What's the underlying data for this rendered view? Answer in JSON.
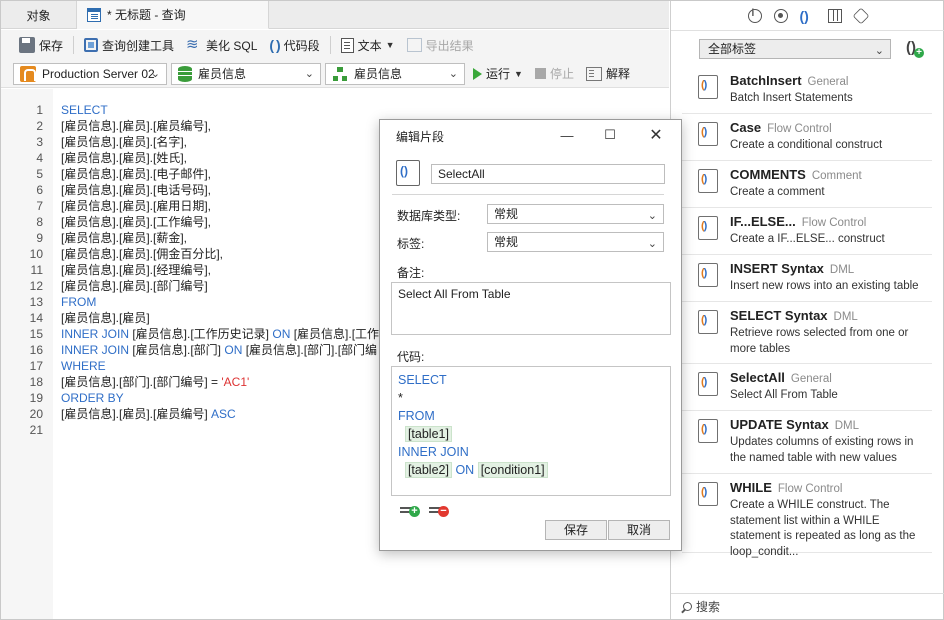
{
  "tabs": {
    "objects": "对象",
    "query": "* 无标题 - 查询"
  },
  "toolbar": {
    "save": "保存",
    "query_builder": "查询创建工具",
    "beautify": "美化 SQL",
    "code_snippet": "代码段",
    "text": "文本",
    "export": "导出结果"
  },
  "connection": {
    "server": "Production Server 02",
    "database": "雇员信息",
    "schema": "雇员信息",
    "run": "运行",
    "stop": "停止",
    "explain": "解释"
  },
  "editor": {
    "lines": [
      {
        "n": "1",
        "parts": [
          {
            "t": "SELECT",
            "k": "kw"
          }
        ]
      },
      {
        "n": "2",
        "parts": [
          {
            "t": "[雇员信息].[雇员].[雇员编号],",
            "k": ""
          }
        ]
      },
      {
        "n": "3",
        "parts": [
          {
            "t": "[雇员信息].[雇员].[名字],",
            "k": ""
          }
        ]
      },
      {
        "n": "4",
        "parts": [
          {
            "t": "[雇员信息].[雇员].[姓氏],",
            "k": ""
          }
        ]
      },
      {
        "n": "5",
        "parts": [
          {
            "t": "[雇员信息].[雇员].[电子邮件],",
            "k": ""
          }
        ]
      },
      {
        "n": "6",
        "parts": [
          {
            "t": "[雇员信息].[雇员].[电话号码],",
            "k": ""
          }
        ]
      },
      {
        "n": "7",
        "parts": [
          {
            "t": "[雇员信息].[雇员].[雇用日期],",
            "k": ""
          }
        ]
      },
      {
        "n": "8",
        "parts": [
          {
            "t": "[雇员信息].[雇员].[工作编号],",
            "k": ""
          }
        ]
      },
      {
        "n": "9",
        "parts": [
          {
            "t": "[雇员信息].[雇员].[薪金],",
            "k": ""
          }
        ]
      },
      {
        "n": "10",
        "parts": [
          {
            "t": "[雇员信息].[雇员].[佣金百分比],",
            "k": ""
          }
        ]
      },
      {
        "n": "11",
        "parts": [
          {
            "t": "[雇员信息].[雇员].[经理编号],",
            "k": ""
          }
        ]
      },
      {
        "n": "12",
        "parts": [
          {
            "t": "[雇员信息].[雇员].[部门编号]",
            "k": ""
          }
        ]
      },
      {
        "n": "13",
        "parts": [
          {
            "t": "FROM",
            "k": "kw"
          }
        ]
      },
      {
        "n": "14",
        "parts": [
          {
            "t": "[雇员信息].[雇员]",
            "k": ""
          }
        ]
      },
      {
        "n": "15",
        "parts": [
          {
            "t": "INNER JOIN",
            "k": "kw"
          },
          {
            "t": " [雇员信息].[工作历史记录] ",
            "k": ""
          },
          {
            "t": "ON",
            "k": "kw"
          },
          {
            "t": " [雇员信息].[工作",
            "k": ""
          }
        ]
      },
      {
        "n": "16",
        "parts": [
          {
            "t": "INNER JOIN",
            "k": "kw"
          },
          {
            "t": " [雇员信息].[部门] ",
            "k": ""
          },
          {
            "t": "ON",
            "k": "kw"
          },
          {
            "t": " [雇员信息].[部门].[部门编",
            "k": ""
          }
        ]
      },
      {
        "n": "17",
        "parts": [
          {
            "t": "WHERE",
            "k": "kw"
          }
        ]
      },
      {
        "n": "18",
        "parts": [
          {
            "t": "[雇员信息].[部门].[部门编号] = ",
            "k": ""
          },
          {
            "t": "'AC1'",
            "k": "str"
          }
        ]
      },
      {
        "n": "19",
        "parts": [
          {
            "t": "ORDER BY",
            "k": "kw"
          }
        ]
      },
      {
        "n": "20",
        "parts": [
          {
            "t": "[雇员信息].[雇员].[雇员编号] ",
            "k": ""
          },
          {
            "t": "ASC",
            "k": "kw"
          }
        ]
      },
      {
        "n": "21",
        "parts": []
      }
    ]
  },
  "dialog": {
    "title": "编辑片段",
    "name": "SelectAll",
    "db_type_label": "数据库类型:",
    "db_type_value": "常规",
    "tag_label": "标签:",
    "tag_value": "常规",
    "notes_label": "备注:",
    "notes_value": "Select All From Table",
    "code_label": "代码:",
    "code_lines": [
      [
        {
          "t": "SELECT",
          "k": "kw"
        }
      ],
      [
        {
          "t": "*",
          "k": ""
        }
      ],
      [
        {
          "t": "FROM",
          "k": "kw"
        }
      ],
      [
        {
          "t": "  ",
          "k": ""
        },
        {
          "t": "[table1]",
          "k": "ph"
        }
      ],
      [
        {
          "t": "INNER JOIN",
          "k": "kw"
        }
      ],
      [
        {
          "t": "  ",
          "k": ""
        },
        {
          "t": "[table2]",
          "k": "ph"
        },
        {
          "t": " ",
          "k": ""
        },
        {
          "t": "ON",
          "k": "kw"
        },
        {
          "t": " ",
          "k": ""
        },
        {
          "t": "[condition1]",
          "k": "ph"
        }
      ]
    ],
    "save": "保存",
    "cancel": "取消"
  },
  "right_panel": {
    "filter": "全部标签",
    "search_placeholder": "搜索",
    "snippets": [
      {
        "name": "BatchInsert",
        "category": "General",
        "desc": "Batch Insert Statements"
      },
      {
        "name": "Case",
        "category": "Flow Control",
        "desc": "Create a conditional construct"
      },
      {
        "name": "COMMENTS",
        "category": "Comment",
        "desc": "Create a comment"
      },
      {
        "name": "IF...ELSE...",
        "category": "Flow Control",
        "desc": "Create a IF...ELSE... construct"
      },
      {
        "name": "INSERT Syntax",
        "category": "DML",
        "desc": "Insert new rows into an existing table"
      },
      {
        "name": "SELECT Syntax",
        "category": "DML",
        "desc": "Retrieve rows selected from one or more tables"
      },
      {
        "name": "SelectAll",
        "category": "General",
        "desc": "Select All From Table"
      },
      {
        "name": "UPDATE Syntax",
        "category": "DML",
        "desc": "Updates columns of existing rows in the named table with new values"
      },
      {
        "name": "WHILE",
        "category": "Flow Control",
        "desc": "Create a WHILE construct. The statement list within a WHILE statement is repeated as long as the loop_condit..."
      }
    ]
  }
}
